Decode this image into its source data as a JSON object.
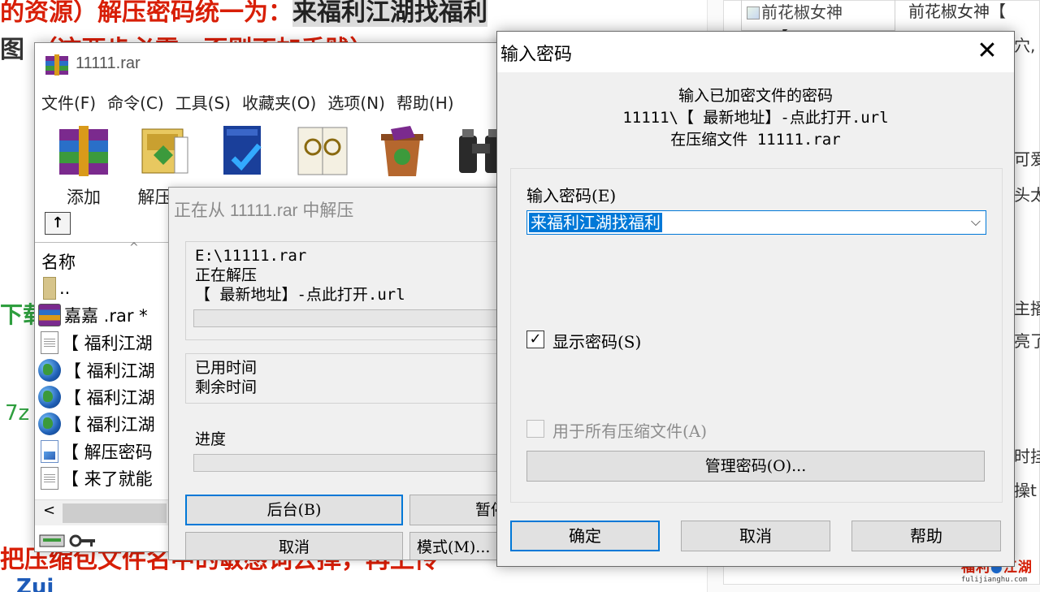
{
  "background_page": {
    "line1_red": "的资源）解压密码统一为：",
    "line1_highlight": "来福利江湖找福利",
    "line2_prefix": "图",
    "line2_red": "（这两步必需，否则不加手贱）",
    "green_fragment_1": "下载",
    "green_fragment_2": "7z",
    "bottom_red": "把压缩包文件名中的敏感词去掉，再上传",
    "bottom_blue": "Zui",
    "sidebar_image_alt": "前花椒女神",
    "sidebar_title": "前花椒女神【",
    "sidebar_frag_1": "【",
    "sidebar_frag_2": "穴,",
    "sidebar_frag_3": "可爱",
    "sidebar_frag_4": "头太",
    "sidebar_frag_5": "主播",
    "sidebar_frag_6": "亮了",
    "sidebar_frag_7": "时挂",
    "sidebar_frag_8": "操t",
    "logo_text_left": "福利",
    "logo_text_mid": "江湖",
    "logo_domain": "fulijianghu.com"
  },
  "winrar": {
    "title": "11111.rar",
    "menu": [
      "文件(F)",
      "命令(C)",
      "工具(S)",
      "收藏夹(O)",
      "选项(N)",
      "帮助(H)"
    ],
    "toolbar": [
      {
        "label": "添加",
        "icon": "add-archive-icon"
      },
      {
        "label": "解压到",
        "icon": "extract-to-icon"
      },
      {
        "label": "测试",
        "icon": "test-icon"
      },
      {
        "label": "查看",
        "icon": "view-icon"
      },
      {
        "label": "删除",
        "icon": "delete-icon"
      },
      {
        "label": "查找",
        "icon": "find-icon"
      }
    ],
    "up_button": "↑",
    "column_name": "名称",
    "sort_indicator": "^",
    "files": [
      {
        "name": "..",
        "icon": "folder-icon"
      },
      {
        "name": "嘉嘉 .rar *",
        "icon": "rar-icon"
      },
      {
        "name": "【 福利江湖",
        "icon": "text-file-icon"
      },
      {
        "name": "【 福利江湖",
        "icon": "globe-icon"
      },
      {
        "name": "【 福利江湖",
        "icon": "globe-icon"
      },
      {
        "name": "【 福利江湖",
        "icon": "globe-icon"
      },
      {
        "name": "【 解压密码",
        "icon": "image-file-icon"
      },
      {
        "name": "【 来了就能",
        "icon": "text-file-icon"
      }
    ],
    "scroll_left": "<"
  },
  "extract_dialog": {
    "title": "正在从 11111.rar 中解压",
    "archive_path": "E:\\11111.rar",
    "status": "正在解压",
    "current_file": "【  最新地址】-点此打开.url",
    "elapsed_label": "已用时间",
    "remaining_label": "剩余时间",
    "progress_label": "进度",
    "progress_value": 0,
    "background_button": "后台(B)",
    "pause_button": "暂停",
    "cancel_button": "取消",
    "mode_button": "模式(M)..."
  },
  "password_dialog": {
    "title": "输入密码",
    "close_glyph": "✕",
    "info_line1": "输入已加密文件的密码",
    "info_line2": "11111\\【  最新地址】-点此打开.url",
    "info_line3": "在压缩文件 11111.rar",
    "password_label": "输入密码(E)",
    "password_value": "来福利江湖找福利",
    "dropdown_glyph": "⌵",
    "show_password_label": "显示密码(S)",
    "show_password_checked": true,
    "check_glyph": "✓",
    "use_for_all_label": "用于所有压缩文件(A)",
    "use_for_all_checked": false,
    "manage_button": "管理密码(O)...",
    "ok_button": "确定",
    "cancel_button": "取消",
    "help_button": "帮助"
  },
  "colors": {
    "accent": "#0078d7",
    "red_text": "#d81e06",
    "green_text": "#2e9e3e",
    "dialog_bg": "#f0f0f0"
  }
}
